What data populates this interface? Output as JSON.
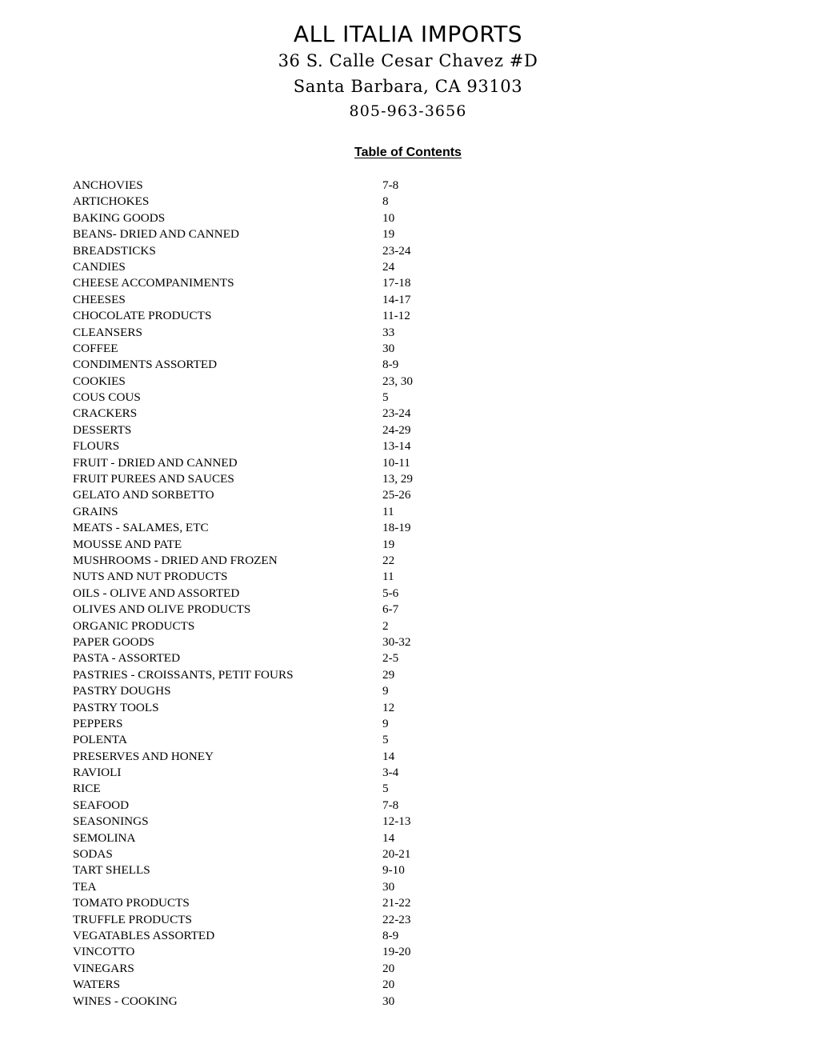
{
  "letterhead": {
    "company": "ALL ITALIA IMPORTS",
    "address_line1": "36 S. Calle Cesar Chavez #D",
    "address_line2": "Santa Barbara, CA 93103",
    "phone": "805-963-3656"
  },
  "heading": {
    "title": "Table of Contents"
  },
  "toc": {
    "entries": [
      {
        "name": "ANCHOVIES",
        "pages": "7-8"
      },
      {
        "name": "ARTICHOKES",
        "pages": "8"
      },
      {
        "name": "BAKING GOODS",
        "pages": "10"
      },
      {
        "name": "BEANS- DRIED AND CANNED",
        "pages": "19"
      },
      {
        "name": "BREADSTICKS",
        "pages": "23-24"
      },
      {
        "name": "CANDIES",
        "pages": "24"
      },
      {
        "name": "CHEESE ACCOMPANIMENTS",
        "pages": "17-18"
      },
      {
        "name": "CHEESES",
        "pages": "14-17"
      },
      {
        "name": "CHOCOLATE PRODUCTS",
        "pages": "11-12"
      },
      {
        "name": "CLEANSERS",
        "pages": "33"
      },
      {
        "name": "COFFEE",
        "pages": "30"
      },
      {
        "name": "CONDIMENTS ASSORTED",
        "pages": "8-9"
      },
      {
        "name": "COOKIES",
        "pages": "23, 30"
      },
      {
        "name": "COUS COUS",
        "pages": "5"
      },
      {
        "name": "CRACKERS",
        "pages": "23-24"
      },
      {
        "name": "DESSERTS",
        "pages": "24-29"
      },
      {
        "name": "FLOURS",
        "pages": "13-14"
      },
      {
        "name": "FRUIT - DRIED AND CANNED",
        "pages": "10-11"
      },
      {
        "name": "FRUIT PUREES AND SAUCES",
        "pages": "13, 29"
      },
      {
        "name": "GELATO AND SORBETTO",
        "pages": "25-26"
      },
      {
        "name": "GRAINS",
        "pages": "11"
      },
      {
        "name": "MEATS - SALAMES, ETC",
        "pages": "18-19"
      },
      {
        "name": "MOUSSE AND PATE",
        "pages": "19"
      },
      {
        "name": "MUSHROOMS - DRIED AND FROZEN",
        "pages": "22"
      },
      {
        "name": "NUTS AND NUT PRODUCTS",
        "pages": "11"
      },
      {
        "name": "OILS - OLIVE AND ASSORTED",
        "pages": "5-6"
      },
      {
        "name": "OLIVES AND OLIVE PRODUCTS",
        "pages": "6-7"
      },
      {
        "name": "ORGANIC PRODUCTS",
        "pages": "2"
      },
      {
        "name": "PAPER GOODS",
        "pages": "30-32"
      },
      {
        "name": "PASTA - ASSORTED",
        "pages": "2-5"
      },
      {
        "name": "PASTRIES - CROISSANTS, PETIT FOURS",
        "pages": "29"
      },
      {
        "name": "PASTRY DOUGHS",
        "pages": "9"
      },
      {
        "name": "PASTRY TOOLS",
        "pages": "12"
      },
      {
        "name": "PEPPERS",
        "pages": "9"
      },
      {
        "name": "POLENTA",
        "pages": "5"
      },
      {
        "name": "PRESERVES AND HONEY",
        "pages": "14"
      },
      {
        "name": "RAVIOLI",
        "pages": "3-4"
      },
      {
        "name": "RICE",
        "pages": "5"
      },
      {
        "name": "SEAFOOD",
        "pages": "7-8"
      },
      {
        "name": "SEASONINGS",
        "pages": "12-13"
      },
      {
        "name": "SEMOLINA",
        "pages": "14"
      },
      {
        "name": "SODAS",
        "pages": "20-21"
      },
      {
        "name": "TART SHELLS",
        "pages": "9-10"
      },
      {
        "name": "TEA",
        "pages": "30"
      },
      {
        "name": "TOMATO PRODUCTS",
        "pages": "21-22"
      },
      {
        "name": "TRUFFLE PRODUCTS",
        "pages": "22-23"
      },
      {
        "name": "VEGATABLES ASSORTED",
        "pages": "8-9"
      },
      {
        "name": "VINCOTTO",
        "pages": "19-20"
      },
      {
        "name": "VINEGARS",
        "pages": "20"
      },
      {
        "name": "WATERS",
        "pages": "20"
      },
      {
        "name": "WINES - COOKING",
        "pages": "30"
      }
    ]
  }
}
